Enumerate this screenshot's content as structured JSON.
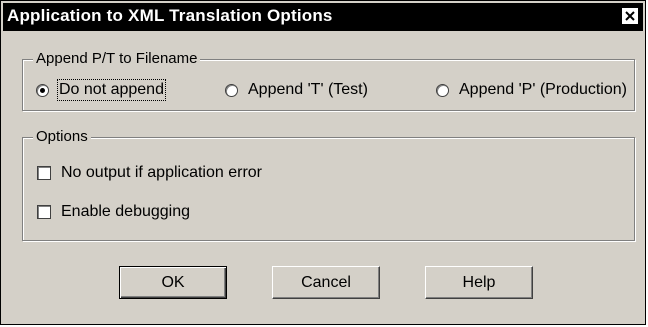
{
  "window": {
    "title": "Application to XML Translation Options",
    "close_icon": "close-icon"
  },
  "append_group": {
    "legend": "Append P/T to Filename",
    "options": [
      {
        "label": "Do not append",
        "selected": true
      },
      {
        "label": "Append 'T' (Test)",
        "selected": false
      },
      {
        "label": "Append 'P' (Production)",
        "selected": false
      }
    ]
  },
  "options_group": {
    "legend": "Options",
    "checkboxes": [
      {
        "label": "No output if application error",
        "checked": false
      },
      {
        "label": "Enable debugging",
        "checked": false
      }
    ]
  },
  "buttons": {
    "ok": "OK",
    "cancel": "Cancel",
    "help": "Help"
  },
  "colors": {
    "face": "#d4d0c8",
    "titlebar": "#000000",
    "title_text": "#ffffff"
  }
}
